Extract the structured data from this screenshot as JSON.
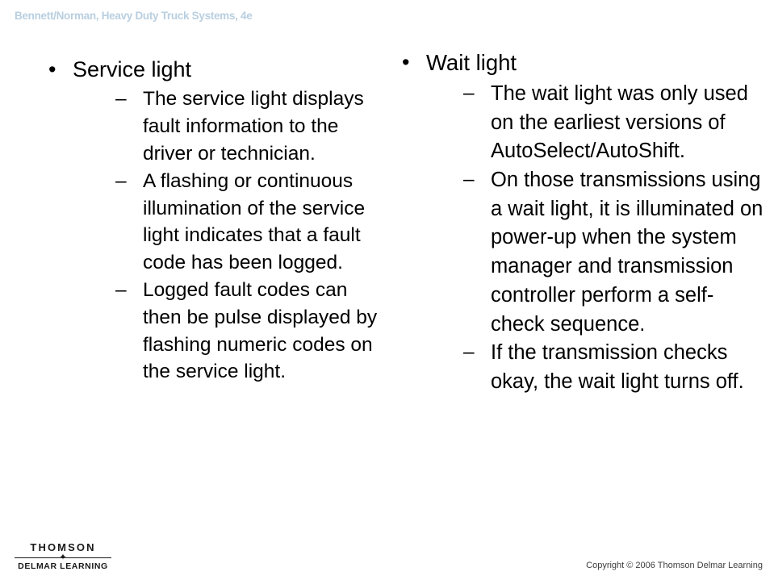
{
  "header": {
    "title": "Bennett/Norman, Heavy Duty Truck Systems, 4e",
    "color": "#b9cfe0"
  },
  "bullet_markers": {
    "level1": "•",
    "level2": "–"
  },
  "columns": {
    "left": {
      "heading": "Service light",
      "sub_bullets": [
        "The service light displays fault information to the driver or technician.",
        "A flashing or continuous illumination of the service light indicates that a fault code has been logged.",
        "Logged fault codes can then be pulse displayed by flashing numeric codes on the service light."
      ]
    },
    "right": {
      "heading": "Wait light",
      "sub_bullets": [
        "The wait light was only used on the earliest versions of AutoSelect/AutoShift.",
        "On those transmissions using a wait light, it is illuminated on power-up when the system manager and transmission controller perform a self-check sequence.",
        "If the transmission checks okay, the wait light turns off."
      ]
    }
  },
  "footer": {
    "logo_top": "THOMSON",
    "logo_star": "✦",
    "logo_bottom": "DELMAR LEARNING",
    "copyright": "Copyright © 2006 Thomson Delmar Learning"
  }
}
